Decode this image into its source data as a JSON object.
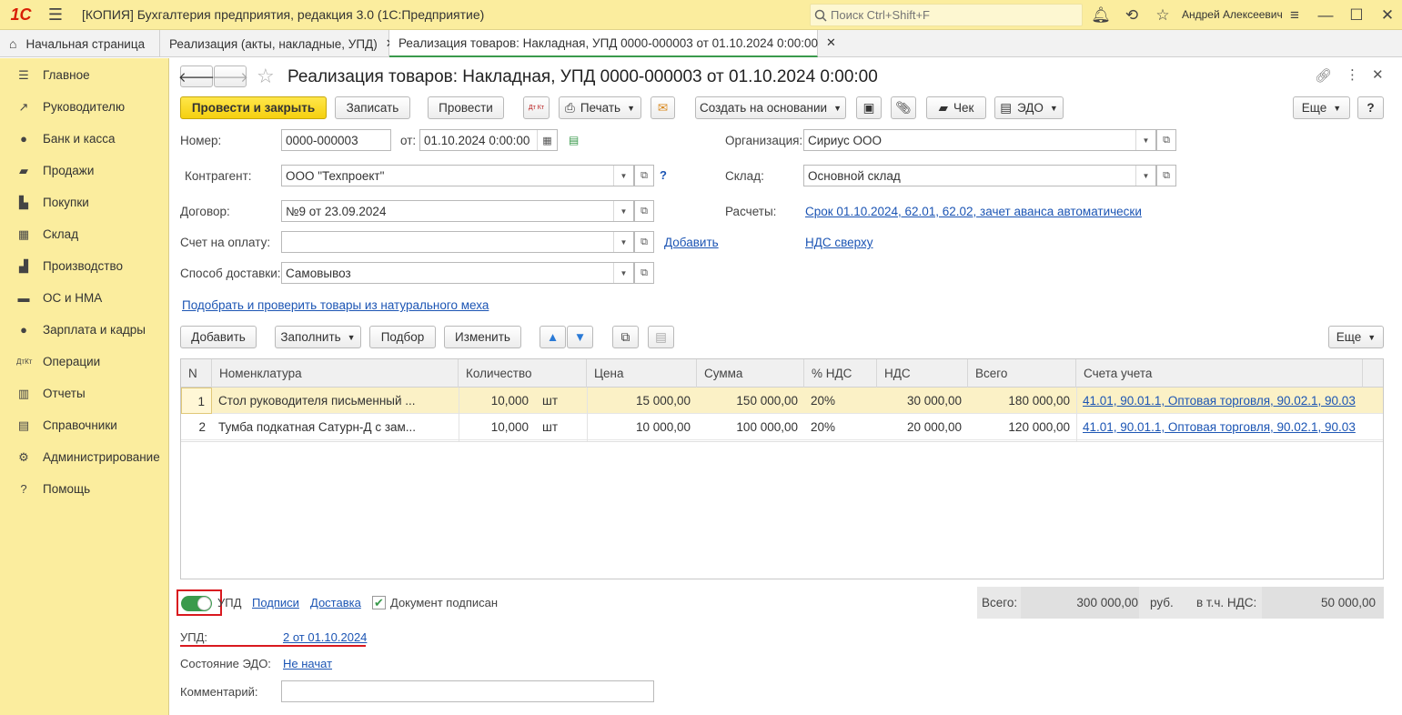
{
  "app": {
    "title": "[КОПИЯ] Бухгалтерия предприятия, редакция 3.0  (1С:Предприятие)",
    "logo": "1С",
    "search_placeholder": "Поиск Ctrl+Shift+F",
    "user": "Андрей Алексеевич"
  },
  "tabs": [
    {
      "label": "Начальная страница"
    },
    {
      "label": "Реализация (акты, накладные, УПД)"
    },
    {
      "label": "Реализация товаров: Накладная, УПД 0000-000003 от 01.10.2024 0:00:00"
    }
  ],
  "sidebar": {
    "items": [
      {
        "label": "Главное",
        "icon": "menu-lines-icon"
      },
      {
        "label": "Руководителю",
        "icon": "trend-icon"
      },
      {
        "label": "Банк и касса",
        "icon": "coin-icon"
      },
      {
        "label": "Продажи",
        "icon": "bag-icon"
      },
      {
        "label": "Покупки",
        "icon": "cart-icon"
      },
      {
        "label": "Склад",
        "icon": "grid-icon"
      },
      {
        "label": "Производство",
        "icon": "factory-icon"
      },
      {
        "label": "ОС и НМА",
        "icon": "truck-icon"
      },
      {
        "label": "Зарплата и кадры",
        "icon": "person-icon"
      },
      {
        "label": "Операции",
        "icon": "dt-kt-icon"
      },
      {
        "label": "Отчеты",
        "icon": "bar-chart-icon"
      },
      {
        "label": "Справочники",
        "icon": "book-icon"
      },
      {
        "label": "Администрирование",
        "icon": "gear-icon"
      },
      {
        "label": "Помощь",
        "icon": "question-icon"
      }
    ]
  },
  "doc": {
    "title": "Реализация товаров: Накладная, УПД 0000-000003 от 01.10.2024 0:00:00"
  },
  "toolbar": {
    "post_close": "Провести и закрыть",
    "save": "Записать",
    "post": "Провести",
    "dtkt": "Дт Кт",
    "print": "Печать",
    "create_based": "Создать на основании",
    "check": "Чек",
    "edo": "ЭДО",
    "more": "Еще",
    "help": "?"
  },
  "form": {
    "number_label": "Номер:",
    "number": "0000-000003",
    "from_label": "от:",
    "date": "01.10.2024  0:00:00",
    "org_label": "Организация:",
    "org": "Сириус ООО",
    "contractor_label": "Контрагент:",
    "contractor": "ООО \"Техпроект\"",
    "warehouse_label": "Склад:",
    "warehouse": "Основной склад",
    "contract_label": "Договор:",
    "contract": "№9 от 23.09.2024",
    "settlements_label": "Расчеты:",
    "settlements_link": "Срок 01.10.2024, 62.01, 62.02, зачет аванса автоматически",
    "invoice_label": "Счет на оплату:",
    "invoice": "",
    "add_link": "Добавить",
    "vat_link": "НДС сверху",
    "delivery_label": "Способ доставки:",
    "delivery": "Самовывоз",
    "fur_link": "Подобрать и проверить товары из натурального меха",
    "question": "?"
  },
  "table_toolbar": {
    "add": "Добавить",
    "fill": "Заполнить",
    "pick": "Подбор",
    "change": "Изменить",
    "more": "Еще"
  },
  "table": {
    "columns": [
      "N",
      "Номенклатура",
      "Количество",
      "Цена",
      "Сумма",
      "% НДС",
      "НДС",
      "Всего",
      "Счета учета"
    ],
    "rows": [
      {
        "n": "1",
        "item": "Стол руководителя письменный ...",
        "qty": "10,000",
        "unit": "шт",
        "price": "15 000,00",
        "sum": "150 000,00",
        "vat_rate": "20%",
        "vat": "30 000,00",
        "total": "180 000,00",
        "accounts": "41.01, 90.01.1, Оптовая торговля, 90.02.1, 90.03"
      },
      {
        "n": "2",
        "item": "Тумба подкатная Сатурн-Д с зам...",
        "qty": "10,000",
        "unit": "шт",
        "price": "10 000,00",
        "sum": "100 000,00",
        "vat_rate": "20%",
        "vat": "20 000,00",
        "total": "120 000,00",
        "accounts": "41.01, 90.01.1, Оптовая торговля, 90.02.1, 90.03"
      }
    ]
  },
  "footer": {
    "upd_toggle": "УПД",
    "signatures_link": "Подписи",
    "delivery_link": "Доставка",
    "signed_label": "Документ подписан",
    "total_label": "Всего:",
    "total": "300 000,00",
    "currency": "руб.",
    "vat_label": "в т.ч. НДС:",
    "vat_total": "50 000,00",
    "upd_label": "УПД:",
    "upd_link": "2 от 01.10.2024",
    "edo_state_label": "Состояние ЭДО:",
    "edo_state_link": "Не начат",
    "comment_label": "Комментарий:",
    "comment": ""
  },
  "colors": {
    "accent_yellow": "#fbed9e",
    "primary_button": "#f5d00f",
    "link": "#1c55b4",
    "highlight_red": "#d9191f",
    "toggle_green": "#3a9a4c"
  }
}
